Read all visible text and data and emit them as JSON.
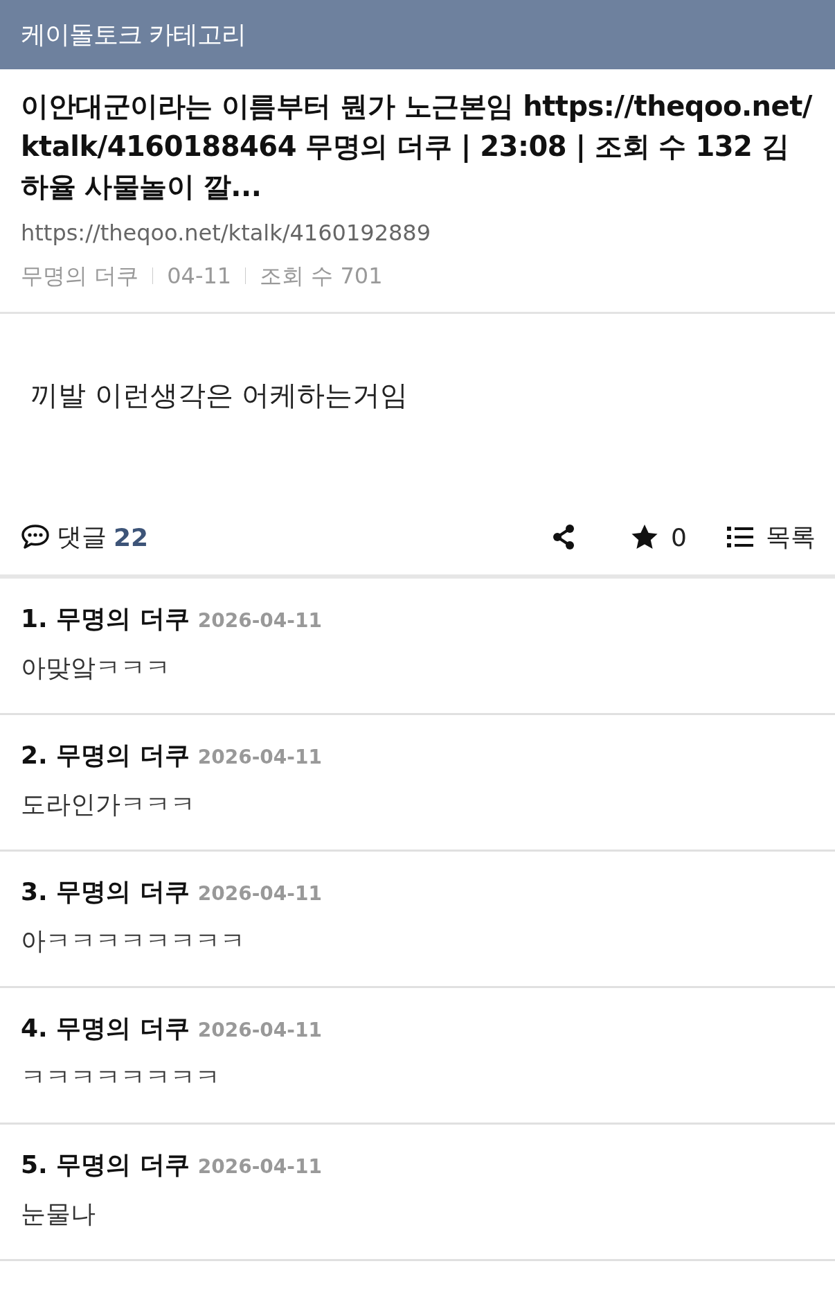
{
  "header": {
    "title": "케이돌토크 카테고리"
  },
  "post": {
    "title": "이안대군이라는 이름부터 뭔가 노근본임 https://theqoo.net/ktalk/4160188464 무명의 더쿠 | 23:08 | 조회 수 132 김하율 사물놀이 깔...",
    "url": "https://theqoo.net/ktalk/4160192889",
    "meta": [
      "무명의 더쿠",
      "04-11",
      "조회 수 701"
    ],
    "body": "끼발 이런생각은 어케하는거임"
  },
  "actions": {
    "comments_label": "댓글",
    "comments_count": "22",
    "vote_count": "0",
    "list_label": "목록"
  },
  "comments": [
    {
      "author": "1. 무명의 더쿠",
      "date": "2026-04-11",
      "text": "아맞앜ㅋㅋㅋ"
    },
    {
      "author": "2. 무명의 더쿠",
      "date": "2026-04-11",
      "text": "도라인가ㅋㅋㅋ"
    },
    {
      "author": "3. 무명의 더쿠",
      "date": "2026-04-11",
      "text": "아ㅋㅋㅋㅋㅋㅋㅋㅋ"
    },
    {
      "author": "4. 무명의 더쿠",
      "date": "2026-04-11",
      "text": "ㅋㅋㅋㅋㅋㅋㅋㅋ"
    },
    {
      "author": "5. 무명의 더쿠",
      "date": "2026-04-11",
      "text": "눈물나"
    }
  ]
}
